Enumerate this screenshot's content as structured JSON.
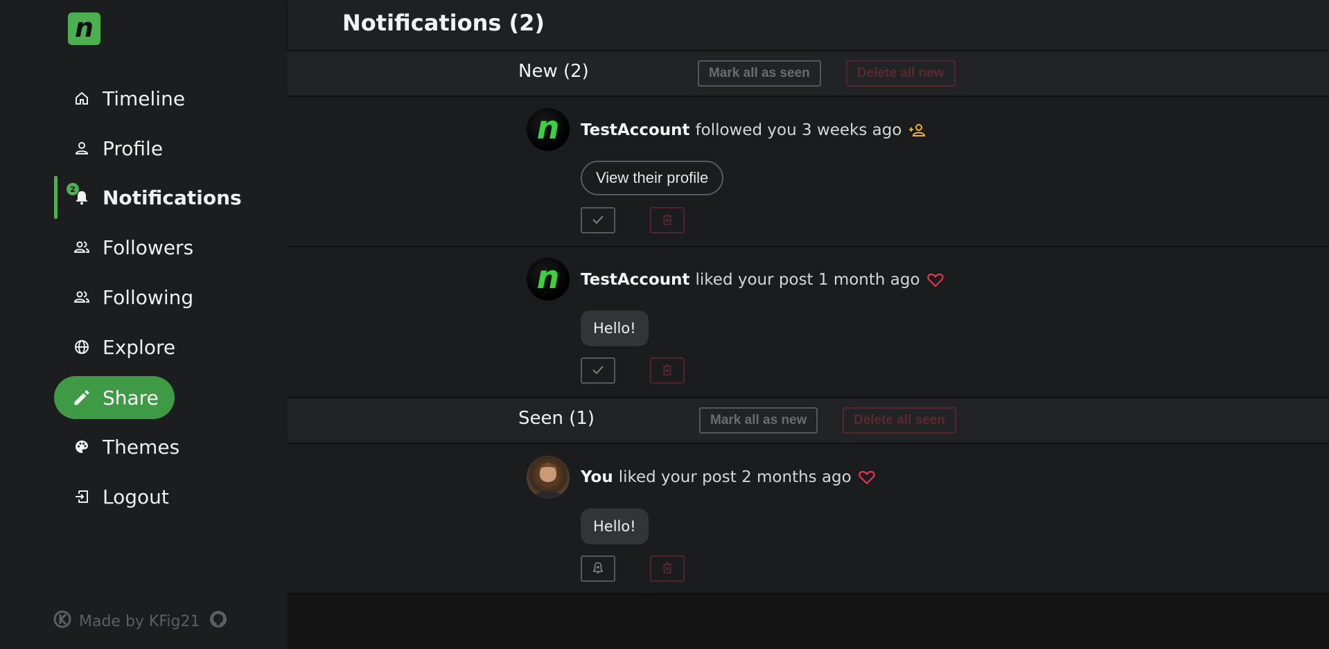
{
  "brand": {
    "logo_letter": "n",
    "accent": "#4caf50"
  },
  "sidebar": {
    "items": [
      {
        "label": "Timeline",
        "icon": "home-icon"
      },
      {
        "label": "Profile",
        "icon": "person-icon"
      },
      {
        "label": "Notifications",
        "icon": "bell-icon",
        "badge": "2",
        "active": true
      },
      {
        "label": "Followers",
        "icon": "people-icon"
      },
      {
        "label": "Following",
        "icon": "people-icon"
      },
      {
        "label": "Explore",
        "icon": "globe-icon"
      },
      {
        "label": "Share",
        "icon": "pencil-icon"
      },
      {
        "label": "Themes",
        "icon": "palette-icon"
      },
      {
        "label": "Logout",
        "icon": "logout-icon"
      }
    ],
    "footer": {
      "text": "Made by KFig21"
    }
  },
  "main": {
    "title": "Notifications (2)",
    "new_section": {
      "title": "New (2)",
      "mark_all_label": "Mark all as seen",
      "delete_all_label": "Delete all new"
    },
    "seen_section": {
      "title": "Seen (1)",
      "mark_all_label": "Mark all as new",
      "delete_all_label": "Delete all seen"
    },
    "notifications": [
      {
        "user": "TestAccount",
        "text": "followed you 3 weeks ago",
        "type_icon": "add-person-icon",
        "type_color": "#f2b418",
        "action_label": "View their profile"
      },
      {
        "user": "TestAccount",
        "text": "liked your post 1 month ago",
        "type_icon": "heart-icon",
        "type_color": "#e8344f",
        "post_text": "Hello!"
      },
      {
        "user": "You",
        "text": "liked your post 2 months ago",
        "type_icon": "heart-icon",
        "type_color": "#e8344f",
        "post_text": "Hello!"
      }
    ]
  }
}
